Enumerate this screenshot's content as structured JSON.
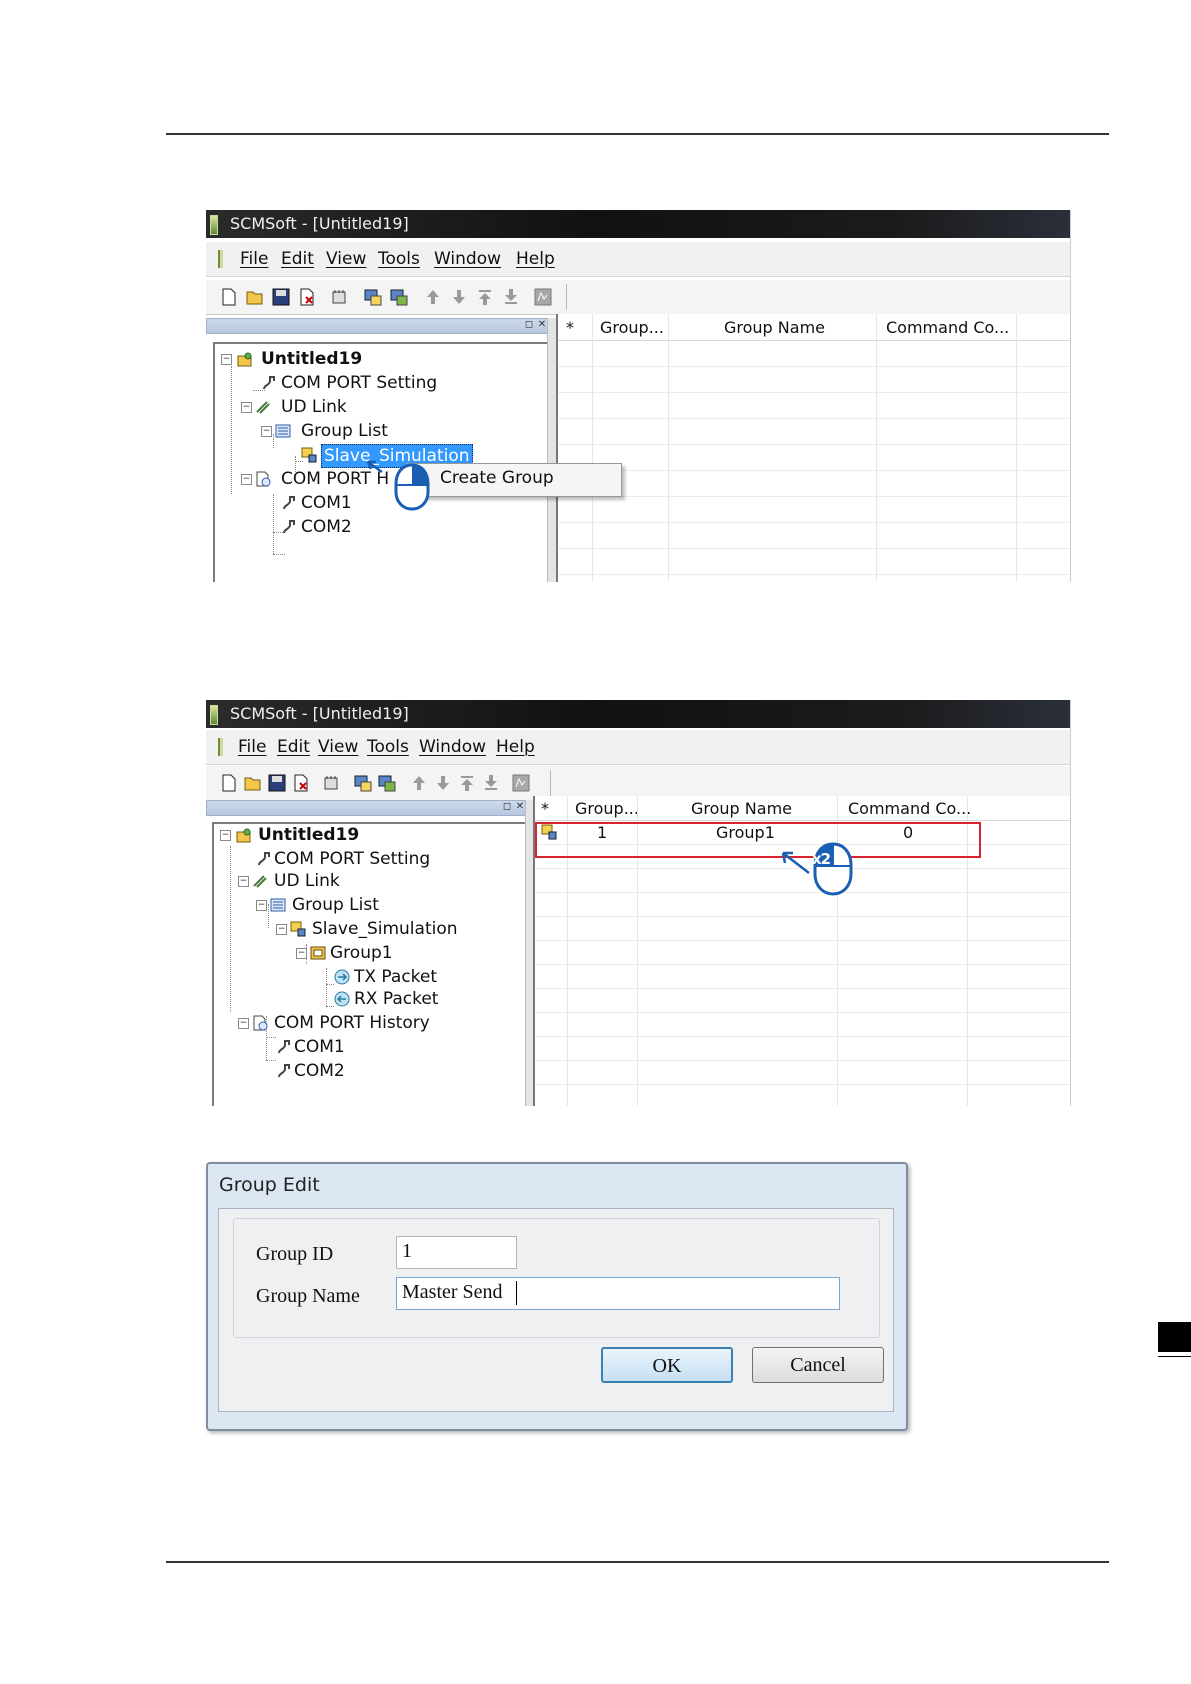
{
  "screenshot1": {
    "window_title": "SCMSoft - [Untitled19]",
    "menu": [
      "File",
      "Edit",
      "View",
      "Tools",
      "Window",
      "Help"
    ],
    "tree": {
      "root": "Untitled19",
      "com_port_setting": "COM PORT Setting",
      "ud_link": "UD Link",
      "group_list": "Group List",
      "slave_simulation": "Slave_Simulation",
      "com_port_history": "COM PORT H",
      "com1": "COM1",
      "com2": "COM2"
    },
    "grid_headers": [
      "*",
      "Group...",
      "Group Name",
      "Command Co..."
    ],
    "context_menu": [
      "Create Group"
    ]
  },
  "screenshot2": {
    "window_title": "SCMSoft - [Untitled19]",
    "menu": [
      "File",
      "Edit",
      "View",
      "Tools",
      "Window",
      "Help"
    ],
    "tree": {
      "root": "Untitled19",
      "com_port_setting": "COM PORT Setting",
      "ud_link": "UD Link",
      "group_list": "Group List",
      "slave_simulation": "Slave_Simulation",
      "group1": "Group1",
      "tx_packet": "TX Packet",
      "rx_packet": "RX Packet",
      "com_port_history": "COM PORT History",
      "com1": "COM1",
      "com2": "COM2"
    },
    "grid_headers": [
      "*",
      "Group...",
      "Group Name",
      "Command Co..."
    ],
    "rows": [
      {
        "group_id": "1",
        "group_name": "Group1",
        "command_count": "0"
      }
    ],
    "double_click_marker": "x2"
  },
  "dialog": {
    "title": "Group Edit",
    "group_id_label": "Group ID",
    "group_id_value": "1",
    "group_name_label": "Group Name",
    "group_name_value": "Master Send",
    "ok_label": "OK",
    "cancel_label": "Cancel"
  },
  "colors": {
    "selection": "#3399ff",
    "highlight_box": "#d9232e",
    "annotation": "#1a5fb4"
  }
}
